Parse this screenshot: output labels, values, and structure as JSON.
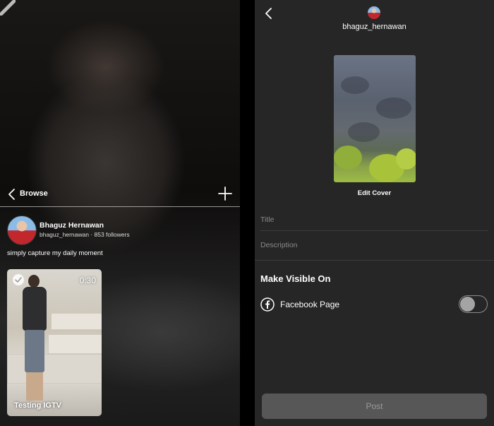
{
  "left": {
    "browse_label": "Browse",
    "channel": {
      "name": "Bhaguz Hernawan",
      "meta": "bhaguz_hernawan · 853 followers",
      "bio": "simply capture my daily moment"
    },
    "video": {
      "duration": "0:30",
      "title": "Testing IGTV"
    }
  },
  "right": {
    "username": "bhaguz_hernawan",
    "edit_cover_label": "Edit Cover",
    "title_placeholder": "Title",
    "description_placeholder": "Description",
    "make_visible_title": "Make Visible On",
    "facebook_label": "Facebook Page",
    "facebook_toggle_on": false,
    "post_label": "Post"
  },
  "colors": {
    "panel_bg": "#262626",
    "post_button_bg": "#575757",
    "toggle_knob": "#a4a4a4"
  },
  "icons": [
    "back-chevron-icon",
    "plus-icon",
    "check-circle-icon",
    "facebook-icon"
  ]
}
